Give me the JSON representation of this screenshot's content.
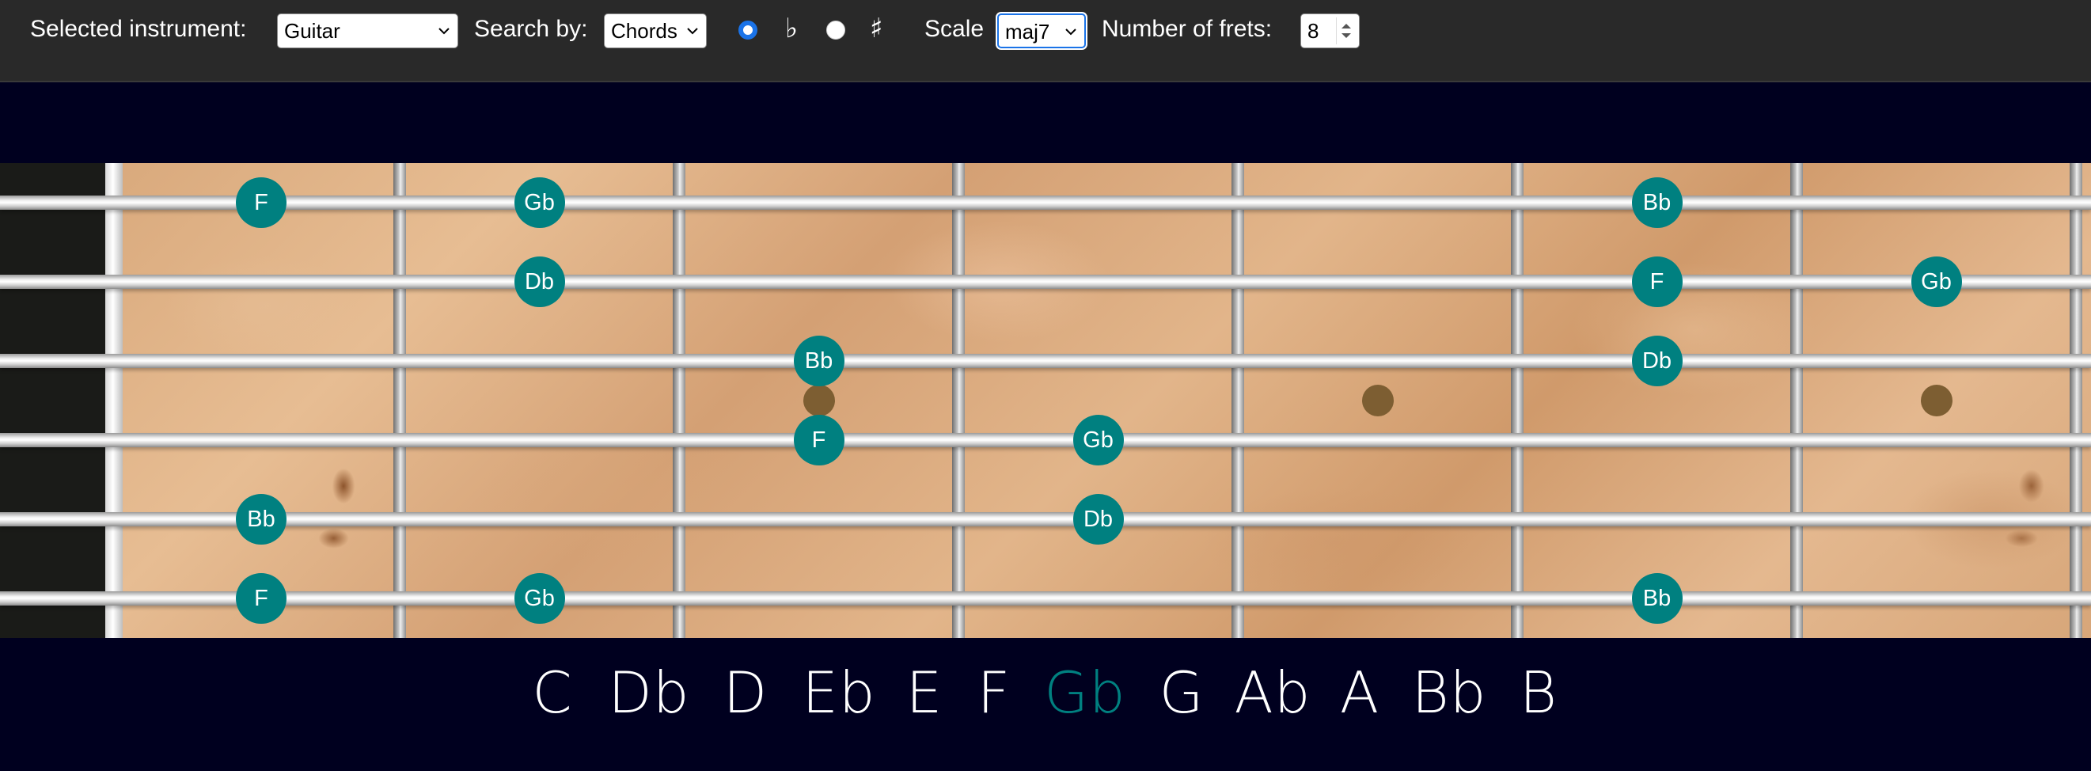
{
  "toolbar": {
    "instrument_label": "Selected instrument:",
    "instrument_value": "Guitar",
    "search_by_label": "Search by:",
    "search_by_value": "Chords",
    "flat_symbol": "♭",
    "sharp_symbol": "♯",
    "accidental_selected": "flat",
    "scale_label": "Scale",
    "scale_value": "maj7",
    "frets_label": "Number of frets:",
    "frets_value": "8"
  },
  "fretboard": {
    "strings": [
      {
        "notes": [
          {
            "fret": 1,
            "label": "F"
          },
          {
            "fret": 2,
            "label": "Gb"
          },
          {
            "fret": 6,
            "label": "Bb"
          }
        ]
      },
      {
        "notes": [
          {
            "fret": 2,
            "label": "Db"
          },
          {
            "fret": 6,
            "label": "F"
          },
          {
            "fret": 7,
            "label": "Gb"
          }
        ]
      },
      {
        "notes": [
          {
            "fret": 3,
            "label": "Bb"
          },
          {
            "fret": 6,
            "label": "Db"
          }
        ]
      },
      {
        "notes": [
          {
            "fret": 3,
            "label": "F"
          },
          {
            "fret": 4,
            "label": "Gb"
          }
        ]
      },
      {
        "notes": [
          {
            "fret": 1,
            "label": "Bb"
          },
          {
            "fret": 4,
            "label": "Db"
          }
        ]
      },
      {
        "notes": [
          {
            "fret": 1,
            "label": "F"
          },
          {
            "fret": 2,
            "label": "Gb"
          },
          {
            "fret": 6,
            "label": "Bb"
          }
        ]
      }
    ],
    "inlay_frets": [
      3,
      5,
      7
    ]
  },
  "keys": {
    "items": [
      "C",
      "Db",
      "D",
      "Eb",
      "E",
      "F",
      "Gb",
      "G",
      "Ab",
      "A",
      "Bb",
      "B"
    ],
    "selected": "Gb"
  },
  "colors": {
    "note_bg": "#008080",
    "selected_key": "#008080",
    "toolbar_bg": "#292929",
    "page_bg": "#00001f",
    "inlay": "#7d5e32"
  }
}
